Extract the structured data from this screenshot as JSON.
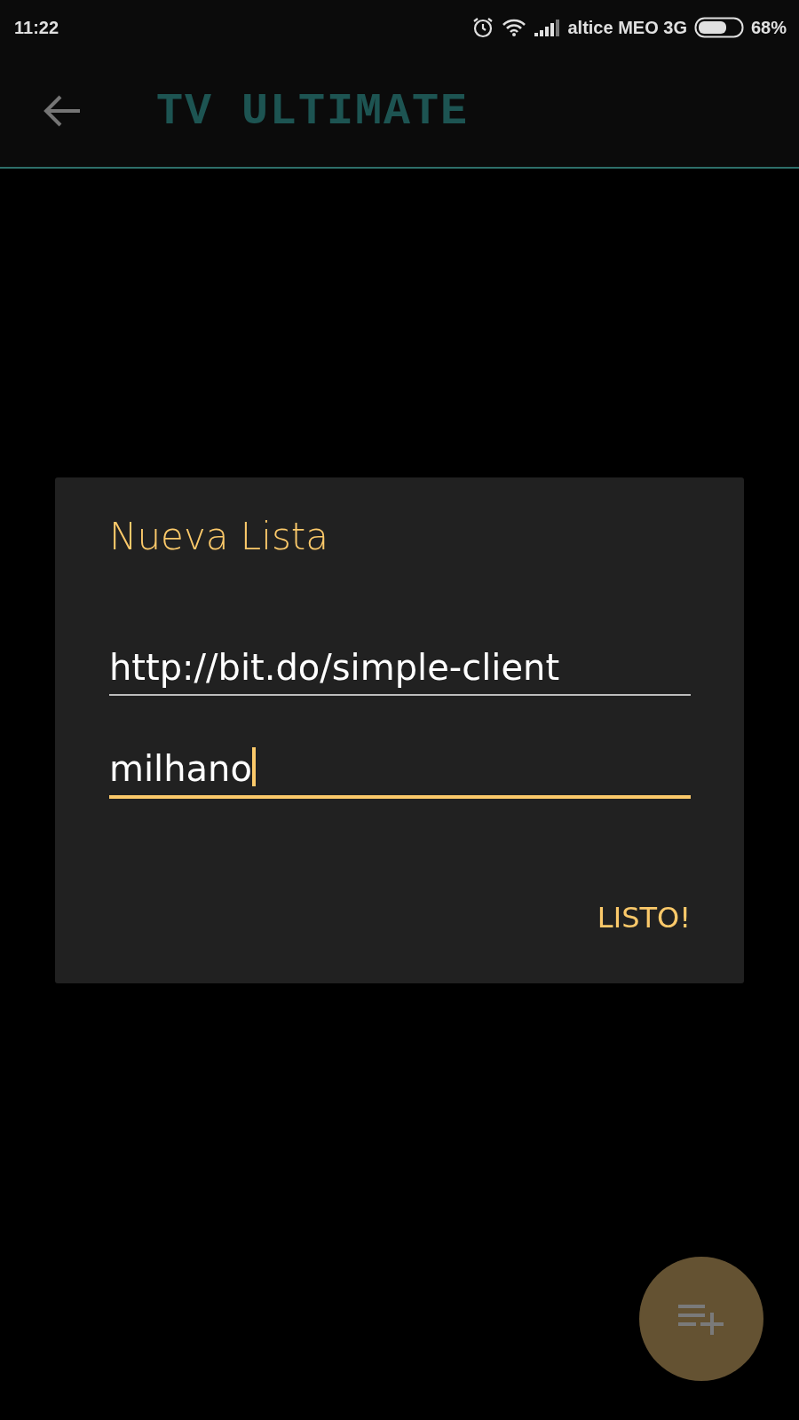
{
  "status_bar": {
    "time": "11:22",
    "carrier": "altice MEO 3G",
    "battery_text": "68%"
  },
  "app_bar": {
    "title": "TV ULTIMATE"
  },
  "dialog": {
    "title": "Nueva Lista",
    "fields": [
      {
        "value": "http://bit.do/simple-client",
        "focused": false
      },
      {
        "value": "milhano",
        "focused": true
      }
    ],
    "button": "LISTO!"
  }
}
